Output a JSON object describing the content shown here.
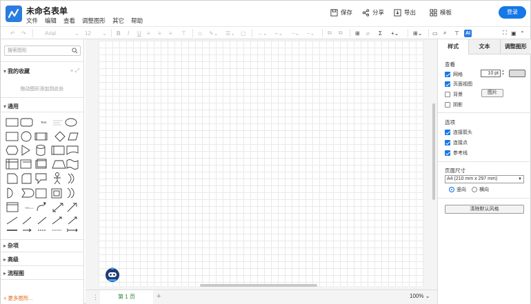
{
  "header": {
    "title": "未命名表单",
    "menu": [
      "文件",
      "编辑",
      "查看",
      "调整图形",
      "其它",
      "帮助"
    ],
    "actions": [
      {
        "label": "保存",
        "icon": "save-icon"
      },
      {
        "label": "分享",
        "icon": "share-icon"
      },
      {
        "label": "导出",
        "icon": "export-icon"
      },
      {
        "label": "模板",
        "icon": "template-icon"
      }
    ],
    "login_label": "登录"
  },
  "toolbar": {
    "font_name": "Arial",
    "font_size": "12",
    "ai_label": "AI"
  },
  "sidebar": {
    "search_placeholder": "搜索图形",
    "favorites_title": "我的收藏",
    "favorites_hint": "拖动图形添加到此处",
    "general_title": "通用",
    "misc_title": "杂项",
    "advanced_title": "高级",
    "flowchart_title": "流程图",
    "more_shapes": "+ 更多图形..."
  },
  "canvas": {
    "page_tab": "第 1 页",
    "zoom": "100%"
  },
  "right_panel": {
    "tabs": [
      "样式",
      "文本",
      "调整图形"
    ],
    "view_title": "查看",
    "grid_label": "网格",
    "grid_size": "10 pt",
    "page_view_label": "页面视图",
    "background_label": "背景",
    "image_button": "图片",
    "shadow_label": "阴影",
    "options_title": "选项",
    "connection_arrows": "连接箭头",
    "connection_points": "连接点",
    "guides": "参考线",
    "paper_size_title": "页面尺寸",
    "paper_size_value": "A4 (210 mm x 297 mm)",
    "portrait": "竖向",
    "landscape": "横向",
    "reset_style": "清除默认风格"
  },
  "colors": {
    "accent": "#1677e6",
    "page_tab_text": "#2a8a3a",
    "more_shapes": "#e06a1a"
  }
}
